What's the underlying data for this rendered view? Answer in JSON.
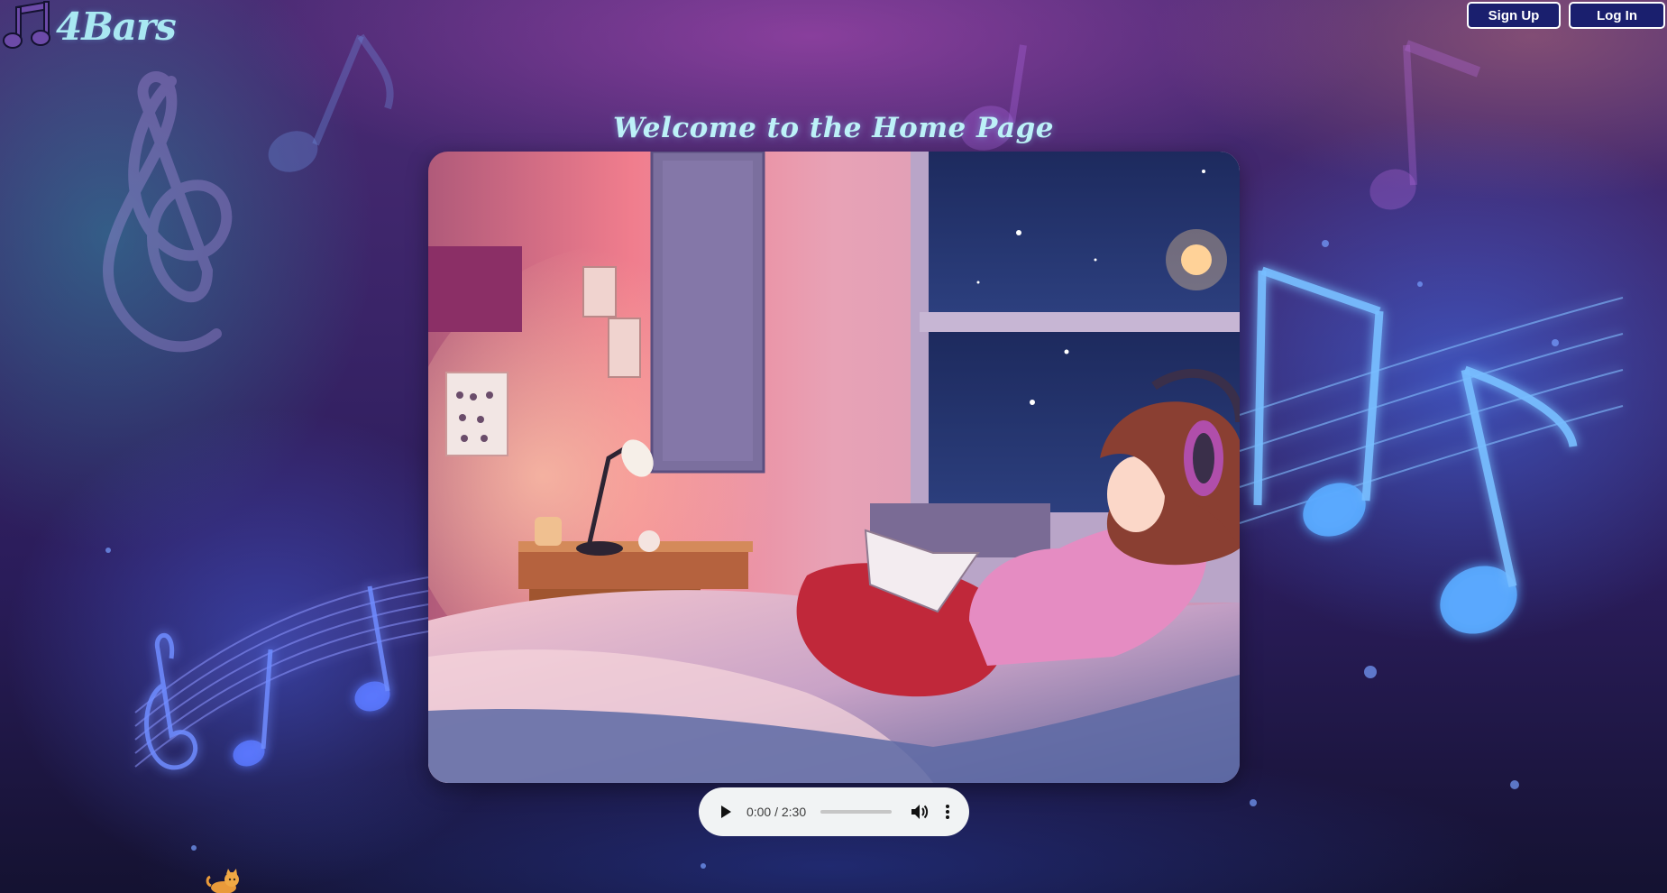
{
  "brand": {
    "name": "4Bars",
    "logo_icon": "music-note-icon",
    "text_color": "#a9e8f2"
  },
  "header": {
    "signup_label": "Sign Up",
    "login_label": "Log In",
    "button_color": "#1a1f6e"
  },
  "main": {
    "title": "Welcome to the Home Page",
    "hero_image": "lofi-girl-bedroom-illustration"
  },
  "player": {
    "current_time": "0:00",
    "duration": "2:30",
    "time_display": "0:00 / 2:30",
    "progress": 0.0,
    "play_icon": "play-icon",
    "volume_icon": "volume-icon",
    "menu_icon": "more-options-icon"
  },
  "footer": {
    "mascot_icon": "cat-icon"
  }
}
